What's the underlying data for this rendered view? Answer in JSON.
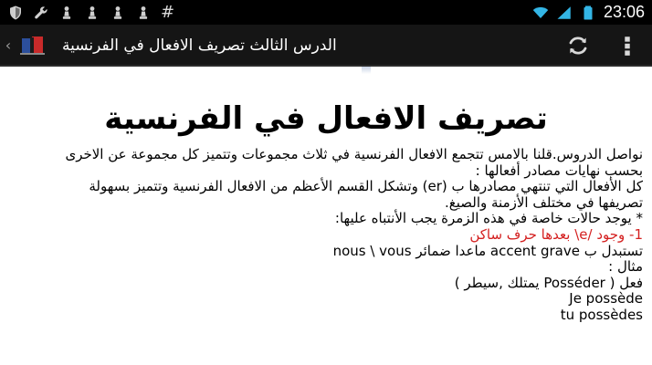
{
  "status_bar": {
    "symbol": "#",
    "time": "23:06",
    "icons": [
      "shield-icon",
      "wrench-icon",
      "chess-pawn-icon",
      "chess-pawn-icon",
      "chess-pawn-icon",
      "chess-pawn-icon",
      "wifi-icon",
      "signal-icon",
      "battery-icon"
    ]
  },
  "action_bar": {
    "title": "الدرس الثالث تصريف الافعال في الفرنسية",
    "logo": "book-logo-icon",
    "actions": [
      "refresh-icon",
      "overflow-menu-icon"
    ]
  },
  "content": {
    "heading": "تصريف الافعال في الفرنسية",
    "lines": [
      "نواصل الدروس.قلنا بالامس تتجمع الافعال الفرنسية في ثلاث مجموعات وتتميز كل مجموعة عن الاخرى",
      "بحسب نهايات مصادر أفعالها :",
      "كل الأفعال التي تنتهي مصادرها ب (er) وتشكل القسم الأعظم من الافعال الفرنسية وتتميز بسهولة",
      "تصريفها في مختلف الأزمنة والصيغ.",
      "* يوجد حالات خاصة في هذه الزمرة يجب الأنتباه عليها:",
      "1- وجود /e\\ بعدها حرف ساكن",
      "تستبدل ب accent grave ماعدا ضمائر nous \\ vous",
      "مثال :",
      "فعل ( Posséder يمتلك ,سيطر )",
      "Je possède",
      "tu possèdes"
    ]
  },
  "colors": {
    "status_bar_bg": "#000000",
    "action_bar_bg": "#151515",
    "highlight_red": "#d42020",
    "wifi_blue": "#33b5e5"
  }
}
